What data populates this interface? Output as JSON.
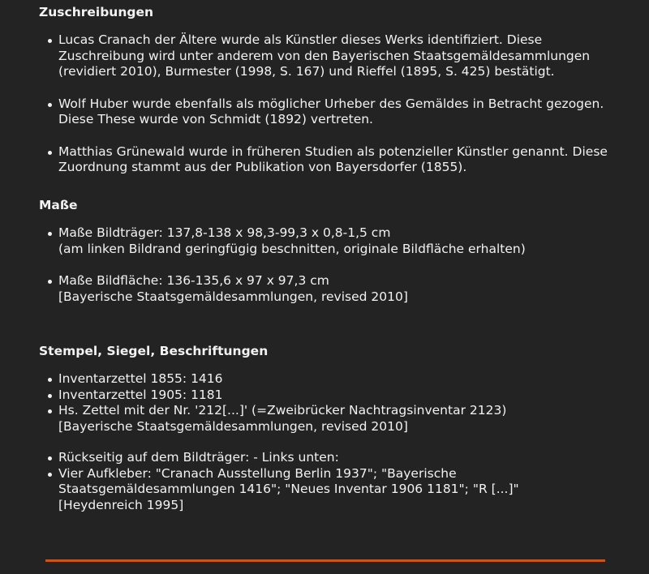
{
  "zuschreibungen": {
    "heading": "Zuschreibungen",
    "items": [
      "Lucas Cranach der Ältere wurde als Künstler dieses Werks identifiziert. Diese Zuschreibung wird unter anderem von den Bayerischen Staatsgemäldesammlungen (revidiert 2010), Burmester (1998, S. 167) und Rieffel (1895, S. 425) bestätigt.",
      "Wolf Huber wurde ebenfalls als möglicher Urheber des Gemäldes in Betracht gezogen. Diese These wurde von Schmidt (1892) vertreten.",
      "Matthias Grünewald wurde in früheren Studien als potenzieller Künstler genannt. Diese Zuordnung stammt aus der Publikation von Bayersdorfer (1855)."
    ]
  },
  "masse": {
    "heading": "Maße",
    "items": [
      {
        "line1": "Maße Bildträger: 137,8-138 x 98,3-99,3 x 0,8-1,5 cm",
        "line2": "(am linken Bildrand geringfügig beschnitten, originale Bildfläche erhalten)"
      },
      {
        "line1": "Maße Bildfläche: 136-135,6 x 97 x 97,3 cm",
        "line2": "[Bayerische Staatsgemäldesammlungen, revised 2010]"
      }
    ]
  },
  "stempel": {
    "heading": "Stempel, Siegel, Beschriftungen",
    "items": [
      "Inventarzettel 1855: 1416",
      "Inventarzettel 1905: 1181",
      "Hs. Zettel mit der Nr. '212[...]' (=Zweibrücker Nachtragsinventar 2123)",
      "[Bayerische Staatsgemäldesammlungen, revised 2010]",
      "Rückseitig auf dem Bildträger: - Links unten:",
      "Vier Aufkleber: \"Cranach Ausstellung Berlin 1937\"; \"Bayerische Staatsgemäldesammlungen 1416\"; \"Neues Inventar 1906 1181\"; \"R [...]\"",
      "[Heydenreich 1995]"
    ]
  }
}
